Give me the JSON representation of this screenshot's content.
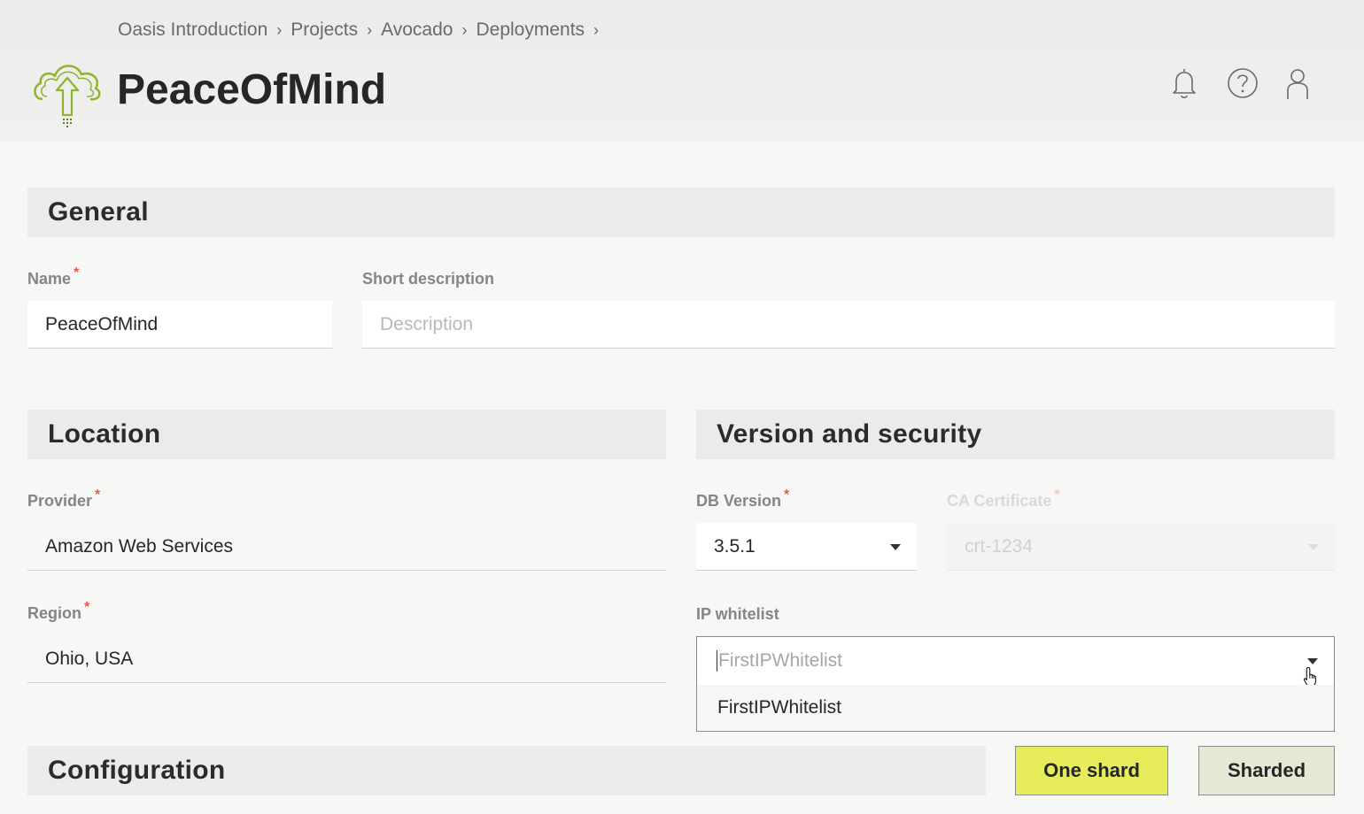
{
  "breadcrumb": [
    "Oasis Introduction",
    "Projects",
    "Avocado",
    "Deployments"
  ],
  "breadcrumb_separator": "›",
  "app": {
    "title": "PeaceOfMind",
    "logo": "cloud-upload-logo"
  },
  "header_icons": [
    "bell-icon",
    "help-icon",
    "user-icon"
  ],
  "general": {
    "heading": "General",
    "name_label": "Name",
    "name_value": "PeaceOfMind",
    "short_description_label": "Short description",
    "short_description_placeholder": "Description"
  },
  "location": {
    "heading": "Location",
    "provider_label": "Provider",
    "provider_value": "Amazon Web Services",
    "region_label": "Region",
    "region_value": "Ohio, USA"
  },
  "version_security": {
    "heading": "Version and security",
    "db_version_label": "DB Version",
    "db_version_value": "3.5.1",
    "ca_certificate_label": "CA Certificate",
    "ca_certificate_value": "crt-1234",
    "ip_whitelist_label": "IP whitelist",
    "ip_whitelist_input": "FirstIPWhitelist",
    "ip_whitelist_options": [
      "FirstIPWhitelist"
    ]
  },
  "configuration": {
    "heading": "Configuration",
    "one_shard_label": "One shard",
    "sharded_label": "Sharded"
  },
  "required_marker": "*",
  "colors": {
    "accent": "#e6ec5a",
    "secondary_button": "#e6e8d6",
    "logo_green": "#8fb32f",
    "required": "#e35d4b"
  }
}
